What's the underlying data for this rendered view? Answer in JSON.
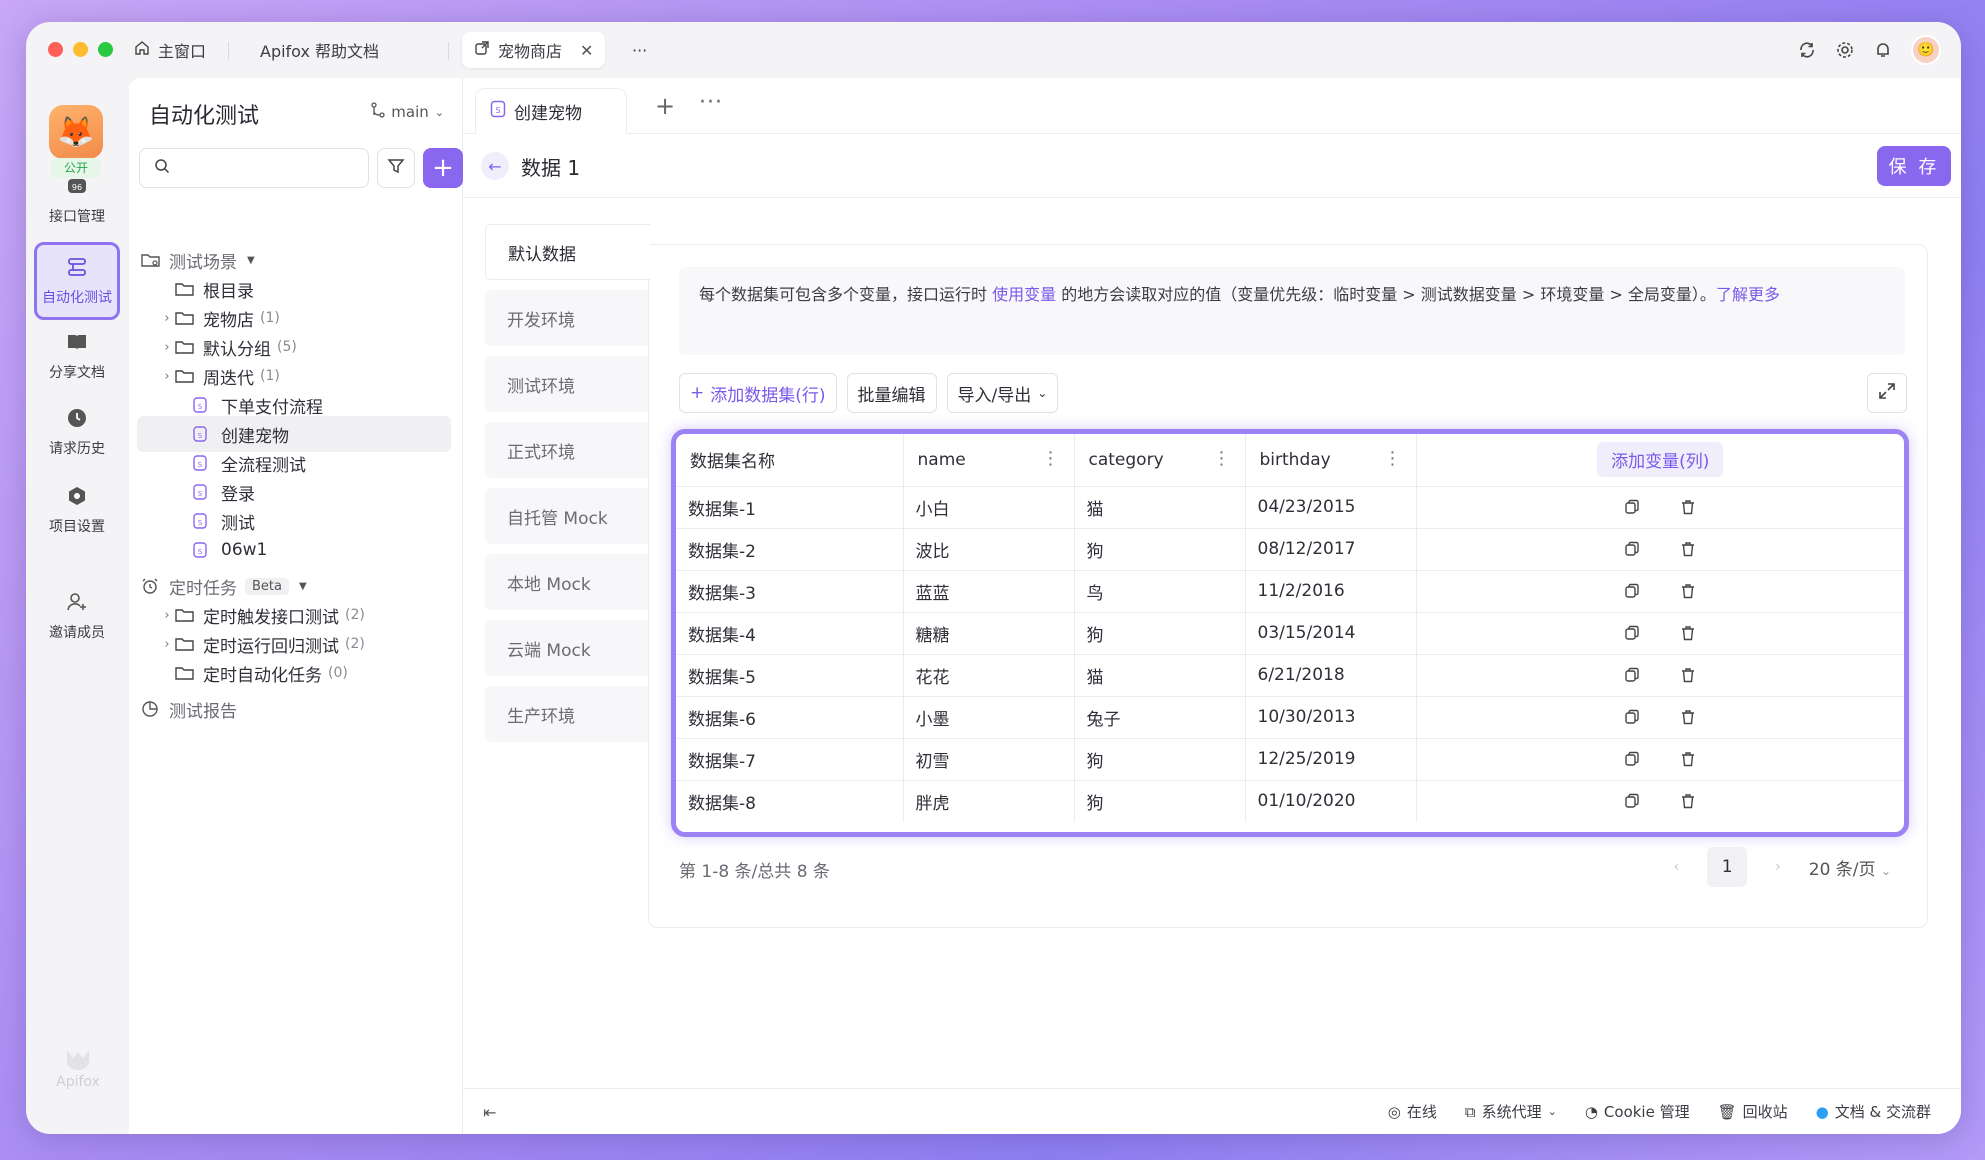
{
  "window_tabs": [
    {
      "label": "主窗口",
      "icon": "home-icon"
    },
    {
      "label": "Apifox 帮助文档"
    },
    {
      "label": "宠物商店",
      "icon": "external-icon",
      "active": true
    },
    {
      "label": "···"
    }
  ],
  "rail": {
    "project_badge": "公开",
    "items": [
      {
        "label": "接口管理",
        "icon": "api-icon"
      },
      {
        "label": "自动化测试",
        "icon": "automation-icon",
        "active": true
      },
      {
        "label": "分享文档",
        "icon": "book-icon"
      },
      {
        "label": "请求历史",
        "icon": "clock-icon"
      },
      {
        "label": "项目设置",
        "icon": "settings-icon"
      },
      {
        "label": "邀请成员",
        "icon": "add-user-icon"
      }
    ],
    "brand": "Apifox"
  },
  "sidebar": {
    "title": "自动化测试",
    "branch": "main",
    "search_placeholder": "",
    "tree": [
      {
        "label": "测试场景",
        "type": "section",
        "icon": "folder-open-icon"
      },
      {
        "label": "根目录",
        "type": "folder"
      },
      {
        "label": "宠物店",
        "count": "(1)",
        "type": "folder",
        "expandable": true
      },
      {
        "label": "默认分组",
        "count": "(5)",
        "type": "folder",
        "expandable": true
      },
      {
        "label": "周迭代",
        "count": "(1)",
        "type": "folder",
        "expandable": true
      },
      {
        "label": "下单支付流程",
        "type": "case"
      },
      {
        "label": "创建宠物",
        "type": "case",
        "selected": true
      },
      {
        "label": "全流程测试",
        "type": "case"
      },
      {
        "label": "登录",
        "type": "case"
      },
      {
        "label": "测试",
        "type": "case"
      },
      {
        "label": "06w1",
        "type": "case"
      },
      {
        "label": "定时任务",
        "badge": "Beta",
        "type": "section",
        "icon": "alarm-icon"
      },
      {
        "label": "定时触发接口测试",
        "count": "(2)",
        "type": "folder",
        "expandable": true
      },
      {
        "label": "定时运行回归测试",
        "count": "(2)",
        "type": "folder",
        "expandable": true
      },
      {
        "label": "定时自动化任务",
        "count": "(0)",
        "type": "folder"
      },
      {
        "label": "测试报告",
        "type": "section",
        "icon": "report-icon"
      }
    ]
  },
  "main": {
    "tab_label": "创建宠物",
    "header_title": "数据 1",
    "save_label": "保 存",
    "envs": [
      "默认数据",
      "开发环境",
      "测试环境",
      "正式环境",
      "自托管 Mock",
      "本地 Mock",
      "云端 Mock",
      "生产环境"
    ],
    "info": {
      "part1": "每个数据集可包含多个变量，接口运行时 ",
      "link1": "使用变量",
      "part2": " 的地方会读取对应的值（变量优先级：临时变量 > 测试数据变量 > 环境变量 > 全局变量）。",
      "link2": "了解更多"
    },
    "toolbar": {
      "add_dataset": "添加数据集(行)",
      "bulk_edit": "批量编辑",
      "import_export": "导入/导出"
    },
    "table": {
      "columns": [
        "数据集名称",
        "name",
        "category",
        "birthday"
      ],
      "add_column": "添加变量(列)",
      "rows": [
        [
          "数据集-1",
          "小白",
          "猫",
          "04/23/2015"
        ],
        [
          "数据集-2",
          "波比",
          "狗",
          "08/12/2017"
        ],
        [
          "数据集-3",
          "蓝蓝",
          "鸟",
          "11/2/2016"
        ],
        [
          "数据集-4",
          "糖糖",
          "狗",
          "03/15/2014"
        ],
        [
          "数据集-5",
          "花花",
          "猫",
          "6/21/2018"
        ],
        [
          "数据集-6",
          "小墨",
          "兔子",
          "10/30/2013"
        ],
        [
          "数据集-7",
          "初雪",
          "狗",
          "12/25/2019"
        ],
        [
          "数据集-8",
          "胖虎",
          "狗",
          "01/10/2020"
        ]
      ]
    },
    "pagination": {
      "info": "第 1-8 条/总共 8 条",
      "page": "1",
      "page_size": "20 条/页"
    }
  },
  "footer": {
    "online": "在线",
    "proxy": "系统代理",
    "cookie": "Cookie 管理",
    "recycle": "回收站",
    "docs": "文档 & 交流群"
  },
  "colors": {
    "accent": "#8a67ef",
    "highlight_border": "#9b82f5"
  }
}
